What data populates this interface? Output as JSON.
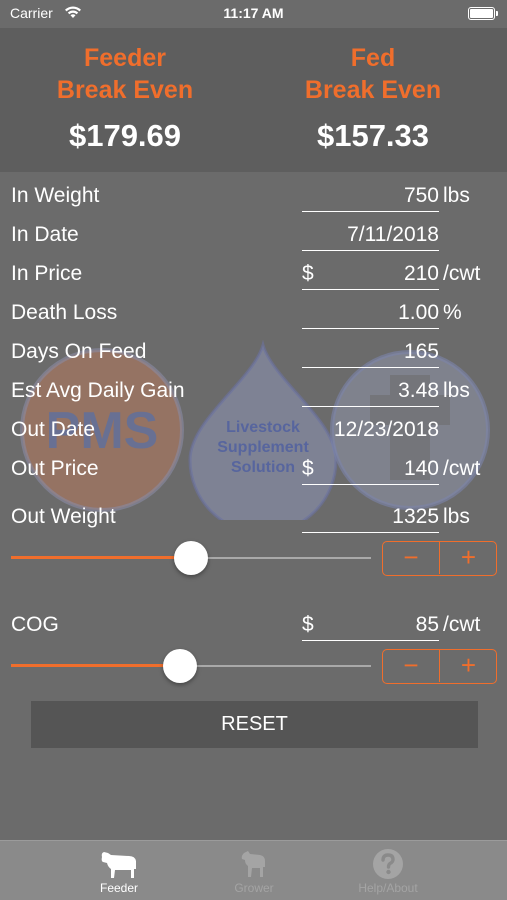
{
  "status_bar": {
    "carrier": "Carrier",
    "time": "11:17 AM"
  },
  "header": {
    "feeder": {
      "title_1": "Feeder",
      "title_2": "Break Even",
      "value": "$179.69"
    },
    "fed": {
      "title_1": "Fed",
      "title_2": "Break Even",
      "value": "$157.33"
    }
  },
  "watermark": {
    "logo_left": "PMS",
    "drop_text": [
      "Livestock",
      "Supplement",
      "Solution"
    ]
  },
  "fields": {
    "in_weight": {
      "label": "In Weight",
      "value": "750",
      "unit": "lbs"
    },
    "in_date": {
      "label": "In Date",
      "value": "7/11/2018"
    },
    "in_price": {
      "label": "In Price",
      "prefix": "$",
      "value": "210",
      "unit": "/cwt"
    },
    "death_loss": {
      "label": "Death Loss",
      "value": "1.00",
      "unit": "%"
    },
    "days_on_feed": {
      "label": "Days On Feed",
      "value": "165"
    },
    "est_adg": {
      "label": "Est Avg Daily Gain",
      "value": "3.48",
      "unit": "lbs"
    },
    "out_date": {
      "label": "Out Date",
      "value": "12/23/2018"
    },
    "out_price": {
      "label": "Out Price",
      "prefix": "$",
      "value": "140",
      "unit": "/cwt"
    },
    "out_weight": {
      "label": "Out Weight",
      "value": "1325",
      "unit": "lbs"
    },
    "cog": {
      "label": "COG",
      "prefix": "$",
      "value": "85",
      "unit": "/cwt"
    }
  },
  "sliders": {
    "out_weight_fraction": 0.5,
    "cog_fraction": 0.47
  },
  "stepper": {
    "minus": "−",
    "plus": "+"
  },
  "reset_label": "RESET",
  "tabs": [
    {
      "label": "Feeder",
      "icon": "cow-icon",
      "active": true
    },
    {
      "label": "Grower",
      "icon": "calf-icon",
      "active": false
    },
    {
      "label": "Help/About",
      "icon": "question-icon",
      "active": false
    }
  ],
  "colors": {
    "accent": "#f06e2c",
    "background": "#6b6b6b",
    "header_bg": "#5e5e5e",
    "tabbar_bg": "#8a8a8a"
  }
}
